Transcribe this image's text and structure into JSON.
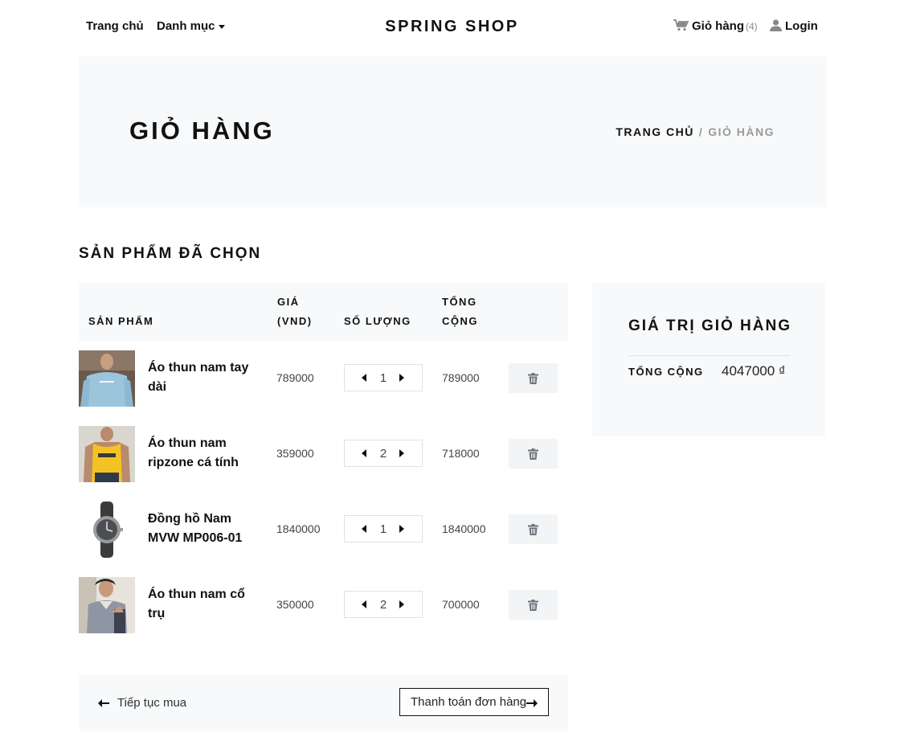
{
  "nav": {
    "home": "Trang chủ",
    "categories": "Danh mục",
    "brand": "SPRING SHOP",
    "cart_label": "Giỏ hàng",
    "cart_count": "(4)",
    "login": "Login"
  },
  "hero": {
    "title": "GIỎ HÀNG",
    "breadcrumb_home": "TRANG CHỦ",
    "breadcrumb_sep": "/",
    "breadcrumb_current": "GIỎ HÀNG"
  },
  "section_title": "SẢN PHẨM ĐÃ CHỌN",
  "table": {
    "headers": {
      "product": "SẢN PHẨM",
      "price": "GIÁ (VND)",
      "quantity": "SỐ LƯỢNG",
      "total": "TỔNG CỘNG"
    },
    "rows": [
      {
        "name": "Áo thun nam tay dài",
        "price": "789000",
        "qty": "1",
        "total": "789000",
        "image": "blue-sweatshirt"
      },
      {
        "name": "Áo thun nam ripzone cá tính",
        "price": "359000",
        "qty": "2",
        "total": "718000",
        "image": "yellow-tank-top"
      },
      {
        "name": "Đồng hồ Nam MVW MP006-01",
        "price": "1840000",
        "qty": "1",
        "total": "1840000",
        "image": "wrist-watch"
      },
      {
        "name": "Áo thun nam cổ trụ",
        "price": "350000",
        "qty": "2",
        "total": "700000",
        "image": "grey-polo-shirt"
      }
    ]
  },
  "footer": {
    "continue": "Tiếp tục mua",
    "checkout": "Thanh toán đơn hàng"
  },
  "summary": {
    "title": "GIÁ TRỊ GIỎ HÀNG",
    "total_label": "TỔNG CỘNG",
    "total_value": "4047000 ₫"
  },
  "colors": {
    "panel_bg": "#f8f9fa",
    "text": "#111111",
    "muted": "#999999",
    "delete_bg": "#f3f4f6",
    "icon_grey": "#6c757d"
  }
}
